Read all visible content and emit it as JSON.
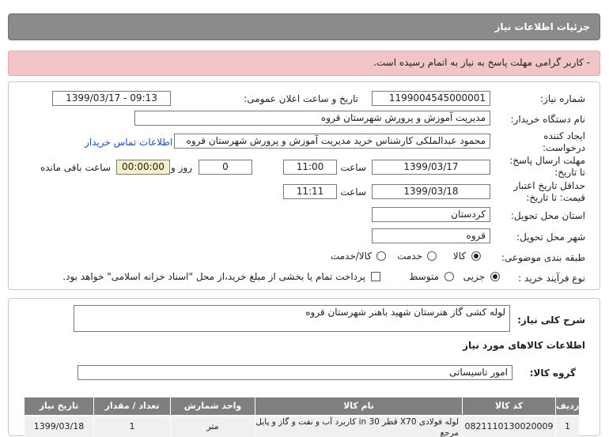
{
  "header": {
    "title": "جزئیات اطلاعات نیاز"
  },
  "alert": {
    "text": "- کاربر گرامی مهلت پاسخ به نیاز به اتمام رسیده است."
  },
  "form": {
    "need_number_label": "شماره نیاز:",
    "need_number": "1199004545000001",
    "announce_label": "تاریخ و ساعت اعلان عمومی:",
    "announce_value": "1399/03/17 - 09:13",
    "buyer_org_label": "نام دستگاه خریدار:",
    "buyer_org": "مدیریت آموزش و پرورش شهرستان قروه",
    "creator_label_1": "ایجاد کننده",
    "creator_label_2": "درخواست:",
    "creator": "محمود عبدالملکی کارشناس خرید مدیریت آموزش و پرورش شهرستان قروه",
    "contact_link": "اطلاعات تماس خریدار",
    "deadline_label_1": "مهلت ارسال پاسخ:",
    "deadline_label_2": "تا تاریخ:",
    "deadline_date": "1399/03/17",
    "time_label": "ساعت",
    "deadline_time": "11:00",
    "days_value": "0",
    "days_label": "روز و",
    "remaining_time": "00:00:00",
    "remaining_label": "ساعت باقی مانده",
    "validity_label_1": "حداقل تاریخ اعتبار",
    "validity_label_2": "قیمت: تا تاریخ:",
    "validity_date": "1399/03/18",
    "validity_time_label": "ساعت",
    "validity_time": "11:11",
    "province_label": "استان محل تحویل:",
    "province": "کردستان",
    "city_label": "شهر محل تحویل:",
    "city": "قروه",
    "category_label": "طبقه بندی موضوعی:",
    "category_options": [
      "کالا",
      "خدمت",
      "کالا/خدمت"
    ],
    "purchase_label": "نوع فرآیند خرید :",
    "purchase_options": [
      "جزیی",
      "متوسط"
    ],
    "payment_note": "پرداخت تمام یا بخشی از مبلغ خرید،از محل \"اسناد خزانه اسلامی\" خواهد بود."
  },
  "details": {
    "description_label": "شرح کلی نیاز:",
    "description": "لوله کشی گاز هنرستان شهید باهنر شهرستان قروه",
    "goods_info_title": "اطلاعات کالاهای مورد نیاز",
    "goods_group_label": "گروه کالا:",
    "goods_group": "امور تاسیساتی"
  },
  "table": {
    "headers": [
      "ردیف",
      "کد کالا",
      "نام کالا",
      "واحد شمارش",
      "تعداد / مقدار",
      "تاریخ نیاز"
    ],
    "rows": [
      {
        "row": "1",
        "code": "0821110130020009",
        "name_1": "لوله فولادی X70 قطر 30 in کاربرد آب و نفت و گاز و پایل مرجع",
        "unit": "متر",
        "qty": "1",
        "date": "1399/03/18"
      }
    ]
  }
}
